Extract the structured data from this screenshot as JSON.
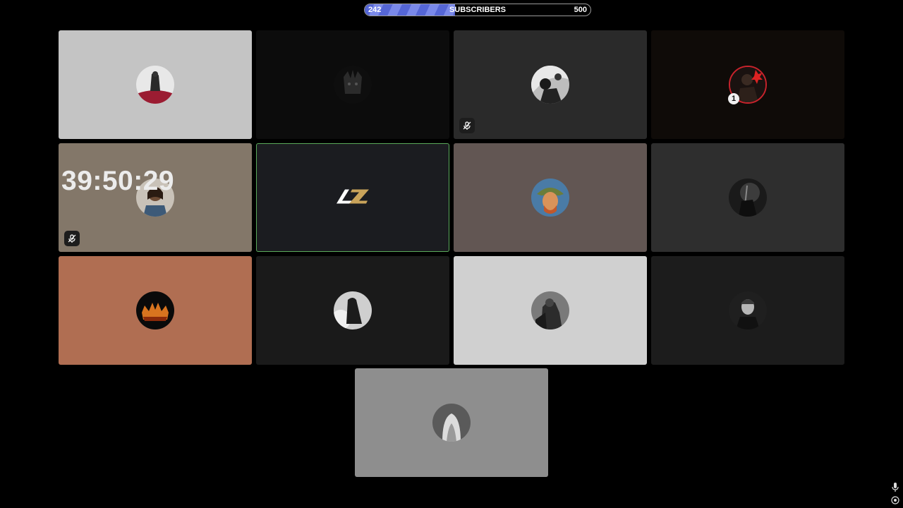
{
  "progress": {
    "current": "242",
    "label": "SUBSCRIBERS",
    "goal": "500",
    "fraction": 0.4,
    "fill_color": "#6677e0"
  },
  "tiles": [
    {
      "name": "participant-1",
      "bg": "#c4c4c4"
    },
    {
      "name": "participant-2",
      "bg": "#0c0c0c"
    },
    {
      "name": "participant-3",
      "bg": "#2a2a2a",
      "muted": true
    },
    {
      "name": "participant-4",
      "bg": "#0f0b08",
      "badge": "1"
    },
    {
      "name": "participant-5",
      "bg": "#837769",
      "muted": true,
      "timer": "39:50:29"
    },
    {
      "name": "participant-6",
      "bg": "#1b1c20",
      "logo": "AZ",
      "active": true,
      "border_color": "#5aaa5a"
    },
    {
      "name": "participant-7",
      "bg": "#625653"
    },
    {
      "name": "participant-8",
      "bg": "#2e2e2e"
    },
    {
      "name": "participant-9",
      "bg": "#b06e52"
    },
    {
      "name": "participant-10",
      "bg": "#1a1a1a"
    },
    {
      "name": "participant-11",
      "bg": "#d0d0d0"
    },
    {
      "name": "participant-12",
      "bg": "#1c1c1c"
    },
    {
      "name": "participant-13",
      "bg": "#8e8e8e"
    }
  ],
  "icons": {
    "muted": "mic-off-icon",
    "mic": "mic-icon",
    "settings": "target-icon"
  }
}
